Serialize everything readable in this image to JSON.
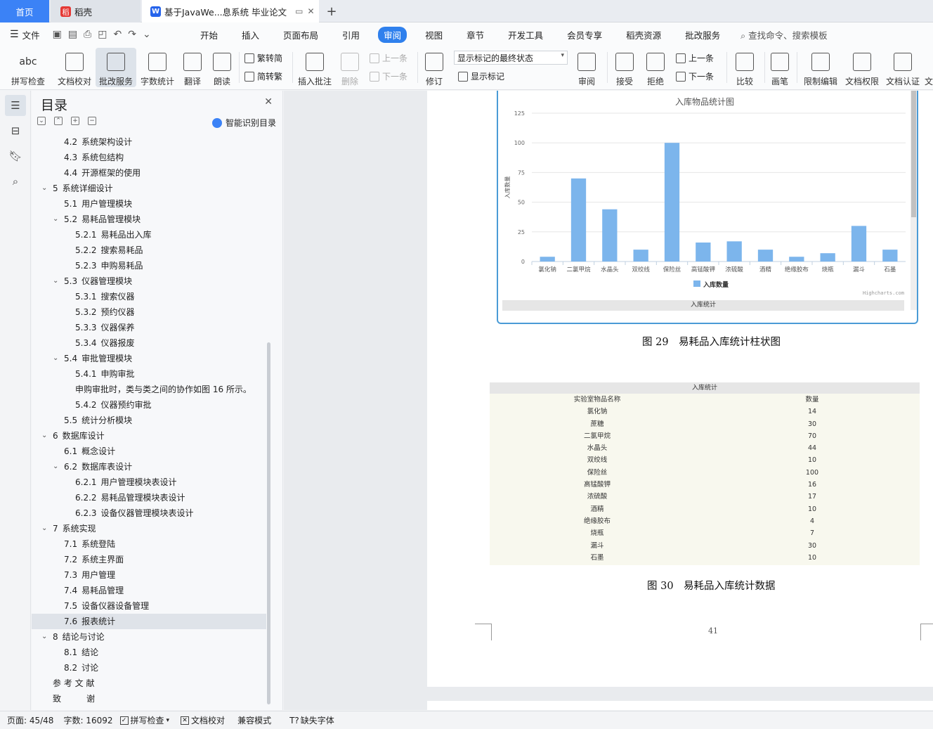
{
  "tabs": {
    "home": "首页",
    "daoke": "稻壳",
    "doc": "基于JavaWe...息系统 毕业论文",
    "add": "+"
  },
  "menubar": {
    "file": "文件",
    "items": [
      "开始",
      "插入",
      "页面布局",
      "引用",
      "审阅",
      "视图",
      "章节",
      "开发工具",
      "会员专享",
      "稻壳资源",
      "批改服务"
    ],
    "active_index": 4,
    "search": "查找命令、搜索模板"
  },
  "ribbon": {
    "spell": "拼写检查",
    "proof": "文档校对",
    "correct": "批改服务",
    "wordcount": "字数统计",
    "translate": "翻译",
    "read": "朗读",
    "trad2simp": "繁转简",
    "simp2trad": "简转繁",
    "insert_comment": "插入批注",
    "delete": "删除",
    "prev": "上一条",
    "next": "下一条",
    "track": "修订",
    "markup_state": "显示标记的最终状态",
    "show_markup": "显示标记",
    "review": "审阅",
    "accept": "接受",
    "reject": "拒绝",
    "prev2": "上一条",
    "next2": "下一条",
    "compare": "比较",
    "pen": "画笔",
    "restrict": "限制编辑",
    "rights": "文档权限",
    "certify": "文档认证",
    "more": "文"
  },
  "toc": {
    "title": "目录",
    "smart": "智能识别目录",
    "items": [
      {
        "num": "4.2",
        "text": "系统架构设计",
        "level": 2
      },
      {
        "num": "4.3",
        "text": "系统包结构",
        "level": 2
      },
      {
        "num": "4.4",
        "text": "开源框架的使用",
        "level": 2
      },
      {
        "num": "5",
        "text": "系统详细设计",
        "level": 1,
        "expanded": true
      },
      {
        "num": "5.1",
        "text": "用户管理模块",
        "level": 2
      },
      {
        "num": "5.2",
        "text": "易耗品管理模块",
        "level": 2,
        "expanded": true
      },
      {
        "num": "5.2.1",
        "text": "易耗品出入库",
        "level": 3
      },
      {
        "num": "5.2.2",
        "text": "搜索易耗品",
        "level": 3
      },
      {
        "num": "5.2.3",
        "text": "申购易耗品",
        "level": 3
      },
      {
        "num": "5.3",
        "text": "仪器管理模块",
        "level": 2,
        "expanded": true
      },
      {
        "num": "5.3.1",
        "text": "搜索仪器",
        "level": 3
      },
      {
        "num": "5.3.2",
        "text": "预约仪器",
        "level": 3
      },
      {
        "num": "5.3.3",
        "text": "仪器保养",
        "level": 3
      },
      {
        "num": "5.3.4",
        "text": "仪器报废",
        "level": 3
      },
      {
        "num": "5.4",
        "text": "审批管理模块",
        "level": 2,
        "expanded": true
      },
      {
        "num": "5.4.1",
        "text": "申购审批",
        "level": 3
      },
      {
        "num": "",
        "text": "申购审批时，类与类之间的协作如图 16 所示。",
        "level": 3
      },
      {
        "num": "5.4.2",
        "text": "仪器预约审批",
        "level": 3
      },
      {
        "num": "5.5",
        "text": "统计分析模块",
        "level": 2
      },
      {
        "num": "6",
        "text": "数据库设计",
        "level": 1,
        "expanded": true
      },
      {
        "num": "6.1",
        "text": "概念设计",
        "level": 2
      },
      {
        "num": "6.2",
        "text": "数据库表设计",
        "level": 2,
        "expanded": true
      },
      {
        "num": "6.2.1",
        "text": "用户管理模块表设计",
        "level": 3
      },
      {
        "num": "6.2.2",
        "text": "易耗品管理模块表设计",
        "level": 3
      },
      {
        "num": "6.2.3",
        "text": "设备仪器管理模块表设计",
        "level": 3
      },
      {
        "num": "7",
        "text": "系统实现",
        "level": 1,
        "expanded": true
      },
      {
        "num": "7.1",
        "text": "系统登陆",
        "level": 2
      },
      {
        "num": "7.2",
        "text": "系统主界面",
        "level": 2
      },
      {
        "num": "7.3",
        "text": "用户管理",
        "level": 2
      },
      {
        "num": "7.4",
        "text": "易耗品管理",
        "level": 2
      },
      {
        "num": "7.5",
        "text": "设备仪器设备管理",
        "level": 2
      },
      {
        "num": "7.6",
        "text": "报表统计",
        "level": 2,
        "selected": true
      },
      {
        "num": "8",
        "text": "结论与讨论",
        "level": 1,
        "expanded": true
      },
      {
        "num": "8.1",
        "text": "结论",
        "level": 2
      },
      {
        "num": "8.2",
        "text": "讨论",
        "level": 2
      },
      {
        "num": "",
        "text": "参 考 文 献",
        "level": 0
      },
      {
        "num": "",
        "text": "致　　　谢",
        "level": 0
      }
    ]
  },
  "chart_data": {
    "type": "bar",
    "title": "入库物品统计图",
    "ylabel": "入库数量",
    "xlabel": "",
    "categories": [
      "氯化钠",
      "二氯甲烷",
      "水晶头",
      "双绞线",
      "保险丝",
      "高锰酸钾",
      "浓硫酸",
      "酒精",
      "绝缘胶布",
      "烧瓶",
      "漏斗",
      "石墨"
    ],
    "series": [
      {
        "name": "入库数量",
        "values": [
          4,
          70,
          44,
          10,
          100,
          16,
          17,
          10,
          4,
          7,
          30,
          10
        ],
        "color": "#7cb5ec"
      }
    ],
    "ylim": [
      0,
      125
    ],
    "yticks": [
      0,
      25,
      50,
      75,
      100,
      125
    ],
    "credit": "Highcharts.com",
    "footer": "入库统计",
    "grid": true,
    "legend": "bottom-center"
  },
  "captions": {
    "fig29": "图 29　易耗品入库统计柱状图",
    "fig30": "图 30　易耗品入库统计数据"
  },
  "table": {
    "title": "入库统计",
    "headers": [
      "实验室物品名称",
      "数量"
    ],
    "rows": [
      [
        "氯化钠",
        "14"
      ],
      [
        "蔗糖",
        "30"
      ],
      [
        "二氯甲烷",
        "70"
      ],
      [
        "水晶头",
        "44"
      ],
      [
        "双绞线",
        "10"
      ],
      [
        "保险丝",
        "100"
      ],
      [
        "高锰酸钾",
        "16"
      ],
      [
        "浓硫酸",
        "17"
      ],
      [
        "酒精",
        "10"
      ],
      [
        "绝缘胶布",
        "4"
      ],
      [
        "烧瓶",
        "7"
      ],
      [
        "漏斗",
        "30"
      ],
      [
        "石墨",
        "10"
      ]
    ]
  },
  "page_number": "41",
  "statusbar": {
    "page": "页面: 45/48",
    "words": "字数: 16092",
    "spell": "拼写检查",
    "proof": "文档校对",
    "compat": "兼容模式",
    "missing_font": "缺失字体"
  }
}
